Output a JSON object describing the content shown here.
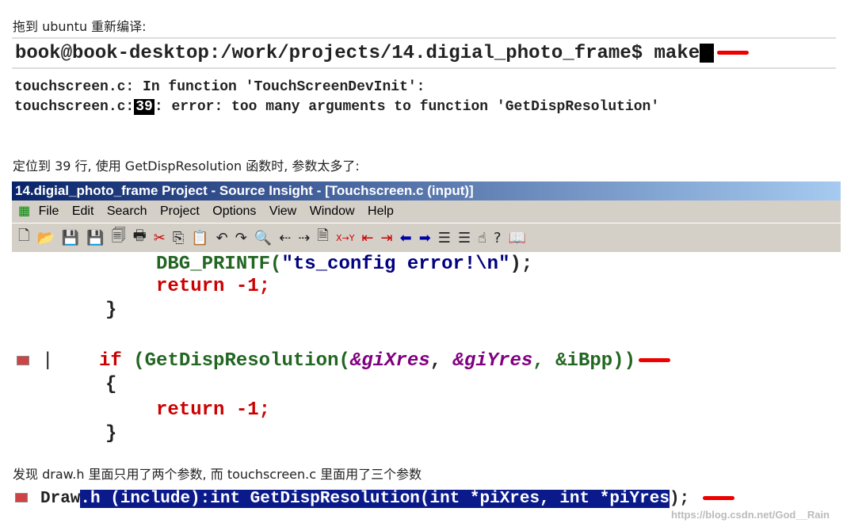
{
  "para1": "拖到 ubuntu 重新编译:",
  "terminal": {
    "prompt": "book@book-desktop:/work/projects/14.digial_photo_frame$ make"
  },
  "errors": {
    "line1": "touchscreen.c: In function 'TouchScreenDevInit':",
    "line2_prefix": "touchscreen.c:",
    "line2_num": "39",
    "line2_suffix": ": error: too many arguments to function 'GetDispResolution'"
  },
  "para2": "定位到 39 行, 使用 GetDispResolution 函数时, 参数太多了:",
  "source_insight": {
    "title": "14.digial_photo_frame Project - Source Insight - [Touchscreen.c (input)]",
    "menu": [
      "File",
      "Edit",
      "Search",
      "Project",
      "Options",
      "View",
      "Window",
      "Help"
    ],
    "code": {
      "l1a": "DBG_PRINTF(",
      "l1b": "\"ts_config error!\\n\"",
      "l1c": ");",
      "l2": "return -1;",
      "l3": "}",
      "l4a": "if",
      "l4b": " (GetDispResolution(",
      "l4c": "&giXres",
      "l4d": ", ",
      "l4e": "&giYres",
      "l4f": ", &iBpp))",
      "l5": "{",
      "l6": "return -1;",
      "l7": "}"
    }
  },
  "para3": "发现 draw.h 里面只用了两个参数, 而 touchscreen.c 里面用了三个参数",
  "bottom": {
    "plain": "Draw",
    "highlight": ".h (include):int GetDispResolution(int *piXres, int *piYres",
    "tail": ");"
  },
  "watermark": "https://blog.csdn.net/God__Rain",
  "colors": {
    "title_bar": "#0a246a",
    "keyword": "#cc0000",
    "highlight": "#0a1a8a"
  }
}
